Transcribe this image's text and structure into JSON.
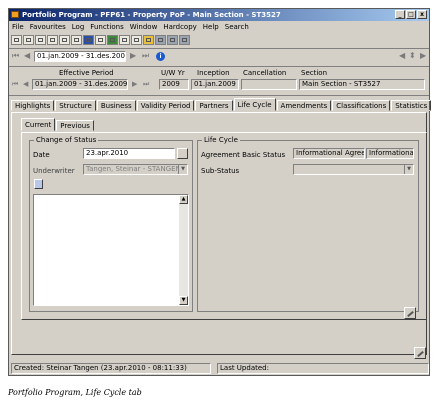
{
  "window": {
    "title": "Portfolio Program - PFP61 - Property PoP - Main Section - ST3527",
    "controls": [
      "_",
      "□",
      "x"
    ]
  },
  "menu": [
    "File",
    "Favourites",
    "Log",
    "Functions",
    "Window",
    "Hardcopy",
    "Help",
    "Search"
  ],
  "nav": {
    "period": "01.jan.2009 - 31.des.2009",
    "info_icon": "i"
  },
  "header": {
    "effective_period_label": "Effective Period",
    "effective_period_value": "01.jan.2009 - 31.des.2009",
    "uw_yr_label": "U/W Yr",
    "uw_yr_value": "2009",
    "inception_label": "Inception",
    "inception_value": "01.jan.2009",
    "cancellation_label": "Cancellation",
    "cancellation_value": "",
    "section_label": "Section",
    "section_value": "Main Section - ST3527"
  },
  "tabs": [
    "Highlights",
    "Structure",
    "Business",
    "Validity Period",
    "Partners",
    "Life Cycle",
    "Amendments",
    "Classifications",
    "Statistics"
  ],
  "active_tab": "Life Cycle",
  "subtabs": [
    "Current",
    "Previous"
  ],
  "active_subtab": "Current",
  "change_of_status": {
    "title": "Change of Status",
    "date_label": "Date",
    "date_value": "23.apr.2010",
    "underwriter_label": "Underwriter",
    "underwriter_value": "Tangen, Steinar - STANGEN"
  },
  "life_cycle": {
    "title": "Life Cycle",
    "agreement_basic_status_label": "Agreement Basic Status",
    "agreement_basic_status_value1": "Informational Agreemen",
    "agreement_basic_status_value2": "Informational",
    "sub_status_label": "Sub-Status",
    "sub_status_value": ""
  },
  "status": {
    "created": "Created: Steinar Tangen (23.apr.2010 - 08:11:33)",
    "last_updated": "Last Updated:"
  },
  "caption": "Portfolio Program, Life Cycle tab",
  "colors": {
    "titlebar_start": "#0a246a",
    "titlebar_end": "#a6caf0",
    "face": "#d4d0c8"
  }
}
